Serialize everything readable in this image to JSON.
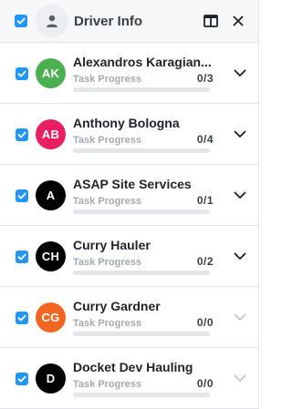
{
  "header": {
    "title": "Driver Info",
    "checked": true,
    "icons": {
      "avatar": "person-icon",
      "layout": "columns-layout-icon",
      "close": "close-icon"
    }
  },
  "drivers": [
    {
      "initials": "AK",
      "name": "Alexandros Karagian...",
      "progress_label": "Task Progress",
      "progress_text": "0/3",
      "progress": 0,
      "color": "#4caf50",
      "checked": true,
      "expandable": true
    },
    {
      "initials": "AB",
      "name": "Anthony Bologna",
      "progress_label": "Task Progress",
      "progress_text": "0/4",
      "progress": 0,
      "color": "#e91e63",
      "checked": true,
      "expandable": true
    },
    {
      "initials": "A",
      "name": "ASAP Site Services",
      "progress_label": "Task Progress",
      "progress_text": "0/1",
      "progress": 0,
      "color": "#000000",
      "checked": true,
      "expandable": true
    },
    {
      "initials": "CH",
      "name": "Curry Hauler",
      "progress_label": "Task Progress",
      "progress_text": "0/2",
      "progress": 0,
      "color": "#000000",
      "checked": true,
      "expandable": true
    },
    {
      "initials": "CG",
      "name": "Curry Gardner",
      "progress_label": "Task Progress",
      "progress_text": "0/0",
      "progress": 0,
      "color": "#f26522",
      "checked": true,
      "expandable": false
    },
    {
      "initials": "D",
      "name": "Docket Dev Hauling",
      "progress_label": "Task Progress",
      "progress_text": "0/0",
      "progress": 0,
      "color": "#000000",
      "checked": true,
      "expandable": false
    }
  ],
  "colors": {
    "accent": "#2196f3",
    "chevron_active": "#1f2328",
    "chevron_disabled": "#c3c7cc"
  }
}
